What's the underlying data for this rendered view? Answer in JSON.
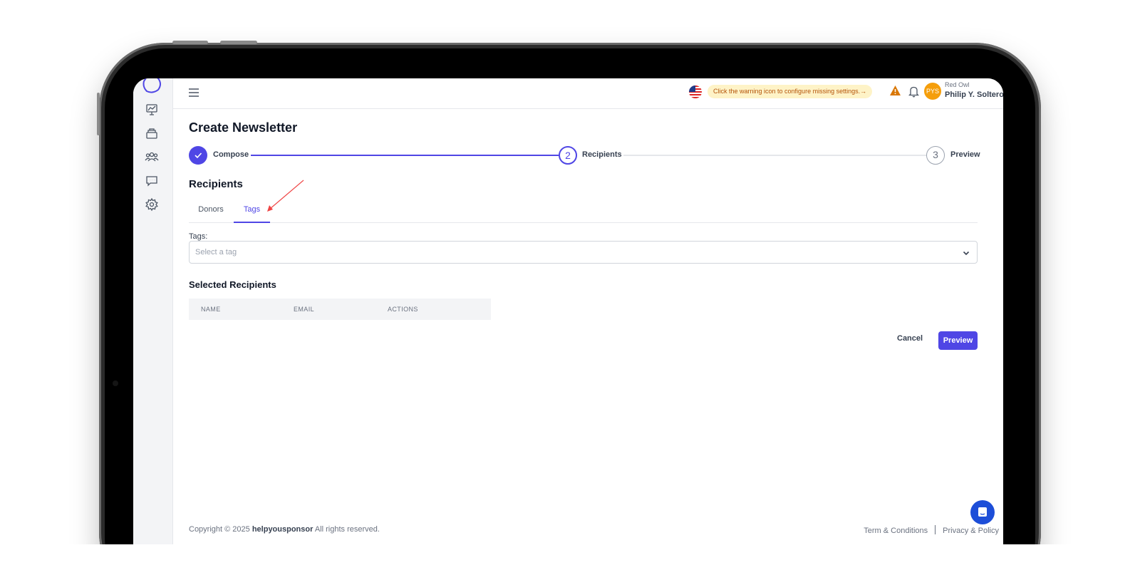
{
  "topbar": {
    "warning_text": "Click the warning icon to configure missing settings.",
    "org_name": "Red Owl",
    "user_name": "Philip Y. Soltero",
    "avatar_initials": "PYS"
  },
  "page": {
    "title": "Create Newsletter"
  },
  "steps": [
    {
      "label": "Compose",
      "number": "1",
      "status": "completed"
    },
    {
      "label": "Recipients",
      "number": "2",
      "status": "current"
    },
    {
      "label": "Preview",
      "number": "3",
      "status": "upcoming"
    }
  ],
  "recipients": {
    "title": "Recipients",
    "tabs": [
      {
        "label": "Donors",
        "active": false
      },
      {
        "label": "Tags",
        "active": true
      }
    ],
    "tags_label": "Tags:",
    "tags_placeholder": "Select a tag"
  },
  "selected_recipients": {
    "title": "Selected Recipients",
    "columns": [
      "NAME",
      "EMAIL",
      "ACTIONS"
    ],
    "rows": []
  },
  "actions": {
    "cancel_label": "Cancel",
    "preview_label": "Preview"
  },
  "footer": {
    "copyright_prefix": "Copyright © 2025",
    "brand": "helpyousponsor",
    "rights": "All rights reserved.",
    "terms": "Term & Conditions",
    "privacy": "Privacy & Policy"
  },
  "colors": {
    "accent": "#4f46e5",
    "warning_bg": "#fef3c7",
    "warning_text": "#b45309",
    "avatar": "#f59e0b",
    "chat_button": "#1d4ed8"
  },
  "icons": [
    "logo-icon",
    "dashboard-chart-icon",
    "archive-icon",
    "users-icon",
    "message-icon",
    "settings-icon",
    "menu-icon",
    "us-flag-icon",
    "warning-icon",
    "bell-icon",
    "chevron-down-icon",
    "chat-icon",
    "check-icon"
  ]
}
